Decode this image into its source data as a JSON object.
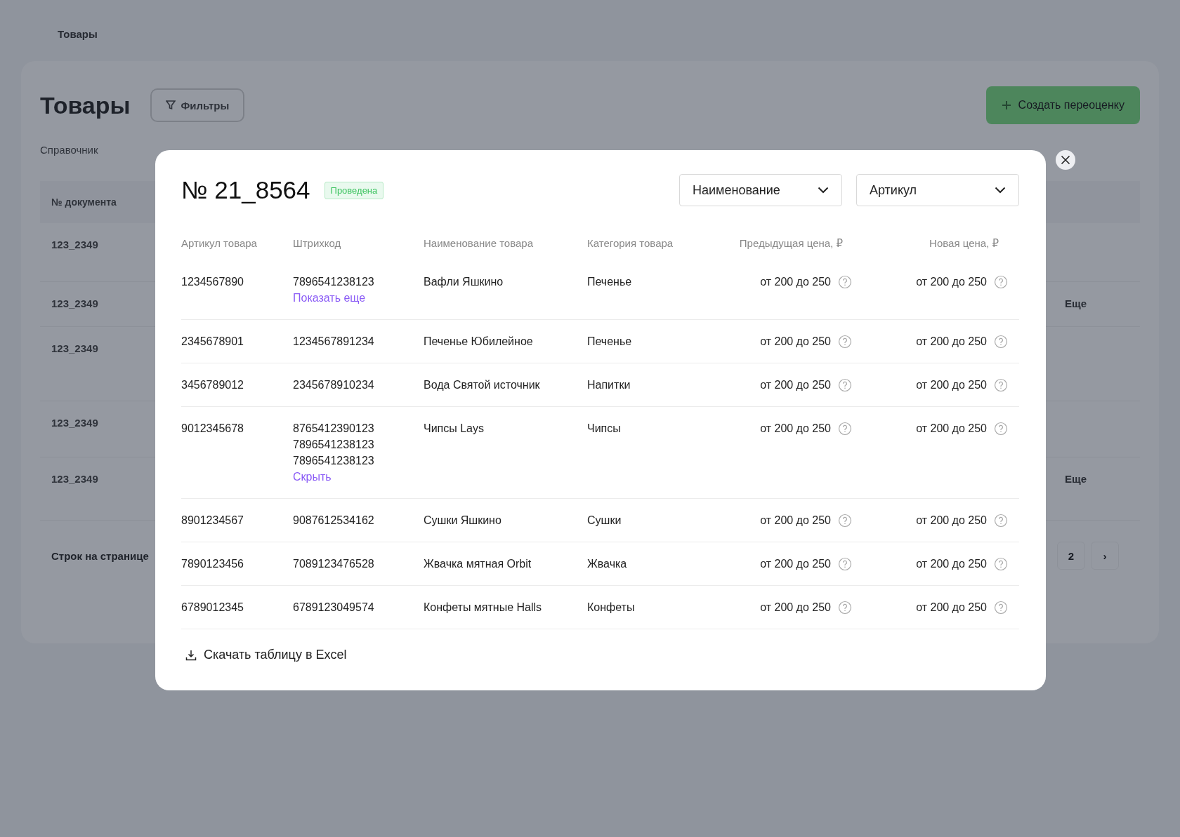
{
  "background": {
    "breadcrumb": [
      "Товары"
    ],
    "title": "Товары",
    "filter_button": "Фильтры",
    "create_button": "Создать переоценку",
    "tabs": [
      "Справочник"
    ],
    "table": {
      "column_1": "№ документа",
      "rows": [
        {
          "number": "123_2349",
          "more": ""
        },
        {
          "number": "123_2349",
          "more": "Еще"
        },
        {
          "number": "123_2349",
          "more": ""
        },
        {
          "number": "123_2349",
          "more": ""
        },
        {
          "number": "123_2349",
          "more": "Еще"
        }
      ]
    },
    "rows_per_page": "Строк на странице",
    "pagination": [
      "2",
      "›"
    ]
  },
  "modal": {
    "title": "№ 21_8564",
    "status": "Проведена",
    "dropdowns": [
      "Наименование",
      "Артикул"
    ],
    "columns": [
      "Артикул товара",
      "Штрихкод",
      "Наименование товара",
      "Категория товара",
      "Предыдущая цена, ₽",
      "Новая цена, ₽"
    ],
    "rows": [
      {
        "article": "1234567890",
        "barcodes": [
          "7896541238123"
        ],
        "toggle": "Показать еще",
        "name": "Вафли Яшкино",
        "category": "Печенье",
        "prev_price": "от 200 до 250",
        "new_price": "от 200 до 250"
      },
      {
        "article": "2345678901",
        "barcodes": [
          "1234567891234"
        ],
        "name": "Печенье Юбилейное",
        "category": "Печенье",
        "prev_price": "от 200 до 250",
        "new_price": "от 200 до 250"
      },
      {
        "article": "3456789012",
        "barcodes": [
          "2345678910234"
        ],
        "name": "Вода Святой источник",
        "category": "Напитки",
        "prev_price": "от 200 до 250",
        "new_price": "от 200 до 250"
      },
      {
        "article": "9012345678",
        "barcodes": [
          "8765412390123",
          "7896541238123",
          "7896541238123"
        ],
        "toggle": "Скрыть",
        "name": "Чипсы Lays",
        "category": "Чипсы",
        "prev_price": "от 200 до 250",
        "new_price": "от 200 до 250"
      },
      {
        "article": "8901234567",
        "barcodes": [
          "9087612534162"
        ],
        "name": "Сушки Яшкино",
        "category": "Сушки",
        "prev_price": "от 200 до 250",
        "new_price": "от 200 до 250"
      },
      {
        "article": "7890123456",
        "barcodes": [
          "7089123476528"
        ],
        "name": "Жвачка мятная Orbit",
        "category": "Жвачка",
        "prev_price": "от 200 до 250",
        "new_price": "от 200 до 250"
      },
      {
        "article": "6789012345",
        "barcodes": [
          "6789123049574"
        ],
        "name": "Конфеты мятные Halls",
        "category": "Конфеты",
        "prev_price": "от 200 до 250",
        "new_price": "от 200 до 250"
      }
    ],
    "download": "Скачать таблицу в Excel"
  }
}
